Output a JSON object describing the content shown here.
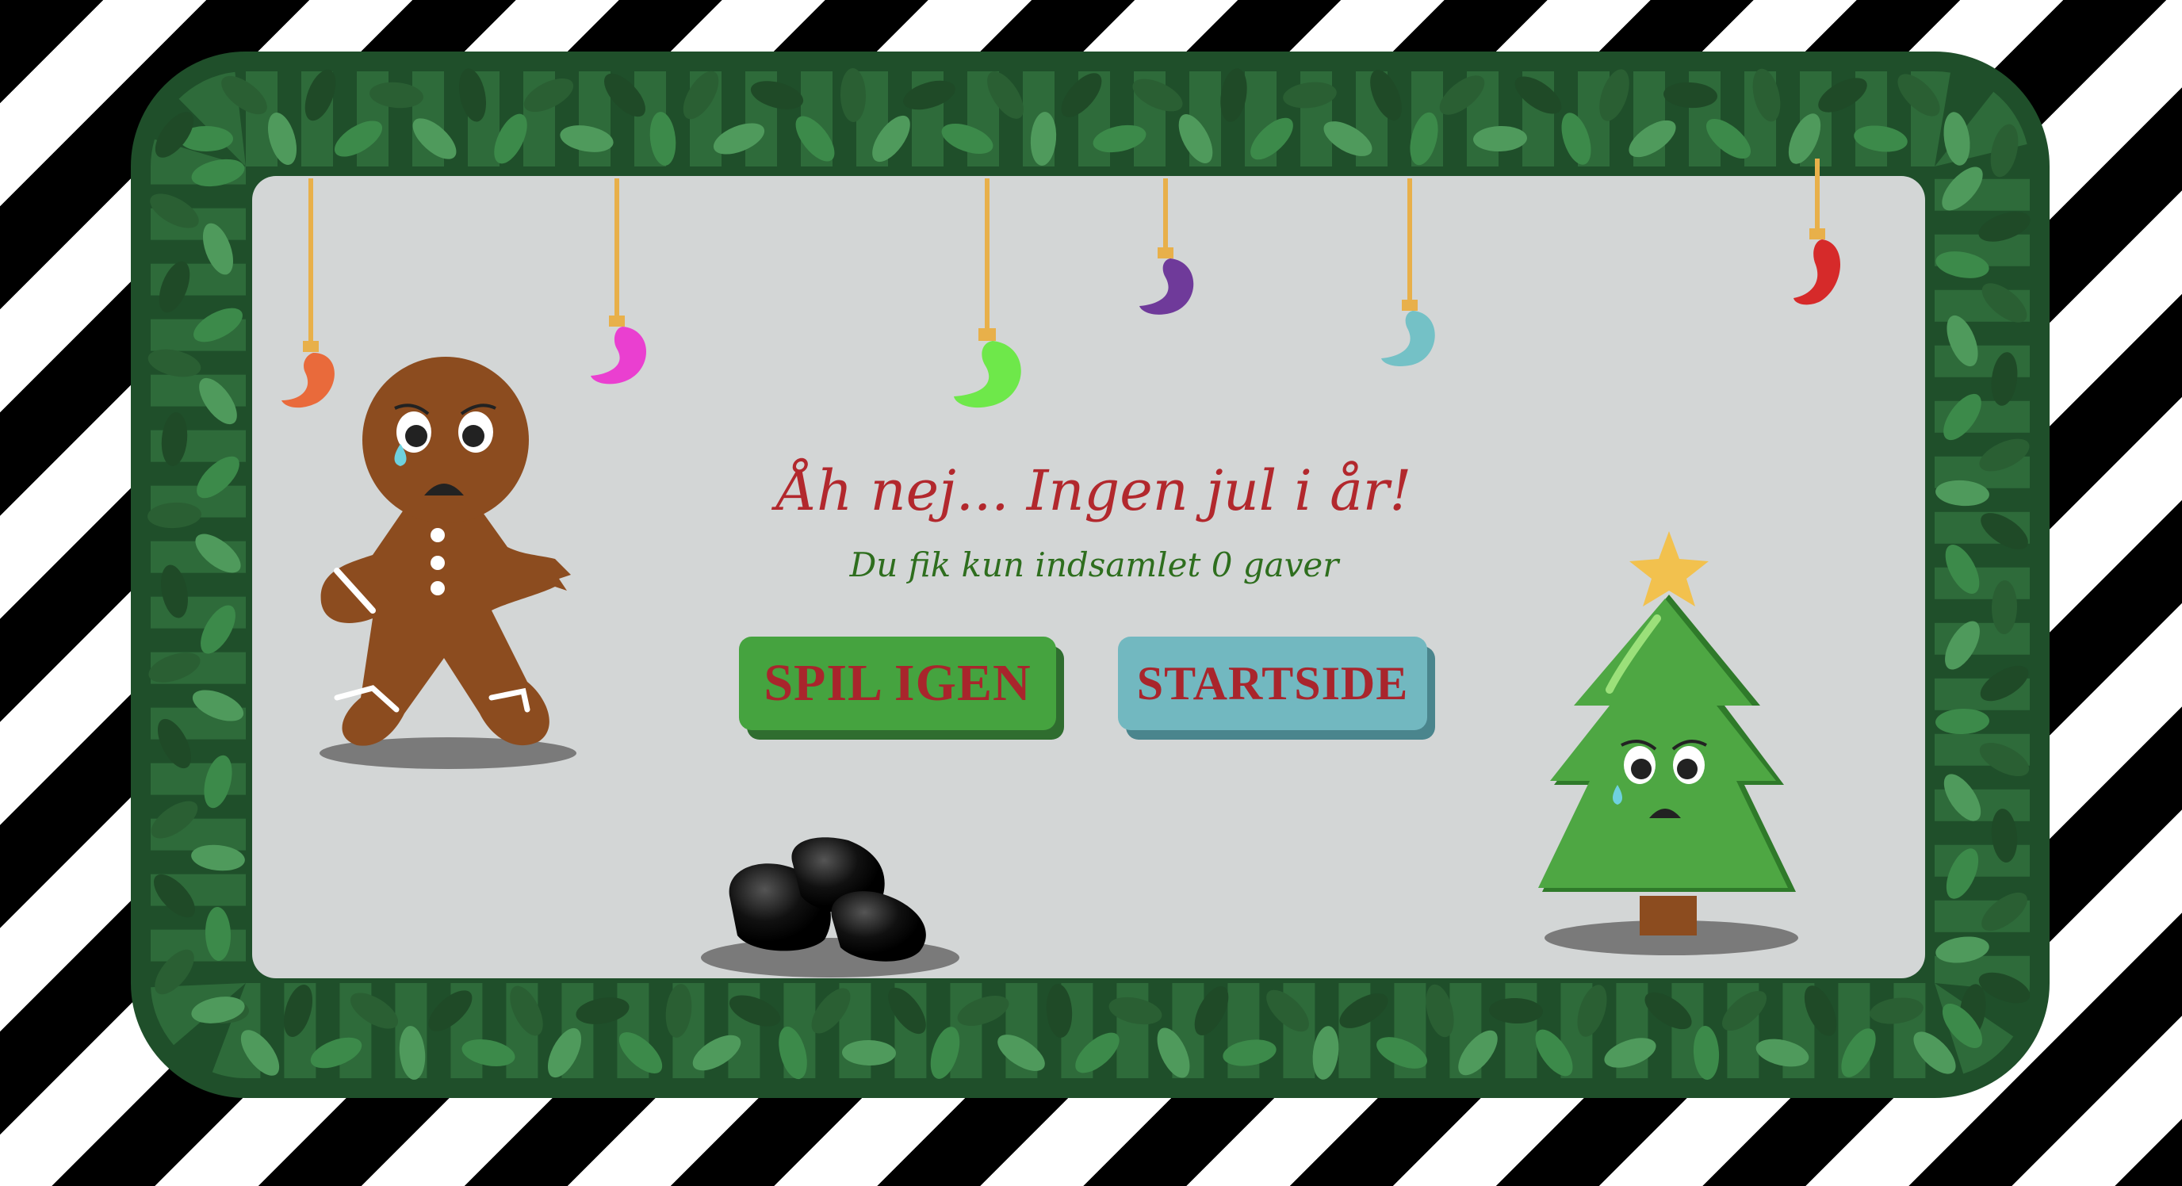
{
  "screen": {
    "title": "Åh nej... Ingen jul i år!",
    "subtitle": "Du fik kun indsamlet 0 gaver",
    "presents_collected": 0
  },
  "buttons": {
    "play_again": "SPIL IGEN",
    "home": "STARTSIDE"
  },
  "colors": {
    "title": "#b2282d",
    "subtitle": "#2e6e1e",
    "play_button": "#45a33f",
    "home_button": "#72b8c0",
    "panel": "#d3d6d6",
    "garland": "#2e6b3a"
  },
  "ornaments": [
    {
      "name": "ornament-orange",
      "color": "#e96a3b"
    },
    {
      "name": "ornament-pink",
      "color": "#ea3fd0"
    },
    {
      "name": "ornament-green",
      "color": "#6ee84a"
    },
    {
      "name": "ornament-purple",
      "color": "#6f3a9a"
    },
    {
      "name": "ornament-teal",
      "color": "#74c1c6"
    },
    {
      "name": "ornament-red",
      "color": "#d62a2a"
    }
  ],
  "characters": [
    "sad-gingerbread-man",
    "sad-christmas-tree",
    "coal-pile"
  ]
}
